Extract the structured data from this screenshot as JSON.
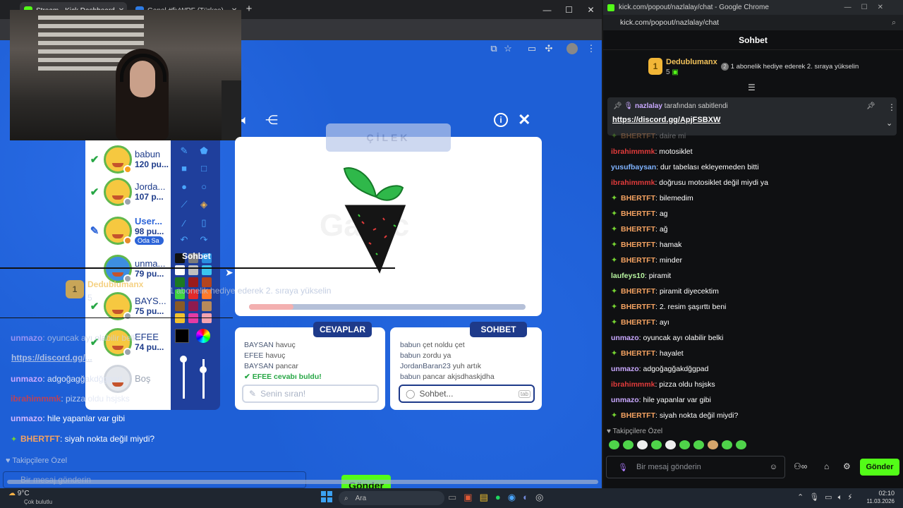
{
  "left_browser": {
    "tabs": [
      {
        "label": "Stream - Kick Dashboard",
        "favicon_color": "#53fc18"
      },
      {
        "label": "Genel #fiyWRF (Türkçe) -",
        "favicon_color": "#2c7be5"
      }
    ],
    "new_tab": "+",
    "window_buttons": [
      "—",
      "☐",
      "✕"
    ]
  },
  "game": {
    "players": [
      {
        "name": "babun",
        "points": "120 pu...",
        "status": "check",
        "dot": "#f59f1c"
      },
      {
        "name": "Jorda...",
        "points": "107 p...",
        "status": "check",
        "dot": "#9aa2ad"
      },
      {
        "name": "User...",
        "points": "98 pu...",
        "status": "pencil",
        "badge": "Oda Sa",
        "dot": "#e58b2a"
      },
      {
        "name": "unma...",
        "points": "79 pu...",
        "status": "none",
        "dot": "#9aa2ad"
      },
      {
        "name": "BAYS...",
        "points": "75 pu...",
        "status": "check",
        "dot": "#9aa2ad"
      },
      {
        "name": "EFEE",
        "points": "74 pu...",
        "status": "check",
        "dot": "#9aa2ad"
      },
      {
        "name": "Boş",
        "points": "",
        "status": "empty",
        "dot": ""
      }
    ],
    "word_hint": "ÇİLEK",
    "watermark": "Gartic",
    "progress_fraction": 0.16,
    "tabs": {
      "answers": "CEVAPLAR",
      "chat": "SOHBET"
    },
    "answers": [
      {
        "user": "BAYSAN",
        "text": "havuç"
      },
      {
        "user": "EFEE",
        "text": "havuç"
      },
      {
        "user": "BAYSAN",
        "text": "pancar"
      }
    ],
    "found": "EFEE cevabı buldu!",
    "answer_placeholder": "Senin sıran!",
    "chat": [
      {
        "user": "babun",
        "text": "çet noldu çet"
      },
      {
        "user": "babun",
        "text": "zordu ya"
      },
      {
        "user": "JordanBaran23",
        "text": "yuh artık"
      },
      {
        "user": "babun",
        "text": "pancar akjsdhaskjdha"
      }
    ],
    "chat_placeholder": "Sohbet...",
    "chat_key": "tab"
  },
  "overlay": {
    "sohbet_label": "Sohbet",
    "rank_user": "Dedublumanx",
    "rank_text": "1 abonelik hediye ederek 2. sıraya yükselin",
    "rank_count": "5",
    "pinned_link": "https://discord.gg/...",
    "lines": [
      {
        "user": "unmazo",
        "text": "oyuncak ayı olabilir belki"
      },
      {
        "user": "BHERTFT",
        "text": "hayalet"
      },
      {
        "user": "unmazo",
        "text": "adgoğagğakdğgpad"
      },
      {
        "user": "ibrahimmmk",
        "text": "pizza oldu hsjsks"
      },
      {
        "user": "unmazo",
        "text": "hile yapanlar var gibi"
      },
      {
        "user": "BHERTFT",
        "text": "siyah nokta değil miydi?"
      }
    ],
    "followers": "Takipçilere Özel",
    "input_placeholder": "Bir mesaj gönderin",
    "send": "Gönder"
  },
  "right": {
    "title": "kick.com/popout/nazlalay/chat - Google Chrome",
    "url": "kick.com/popout/nazlalay/chat",
    "header": "Sohbet",
    "leader": {
      "name": "Dedublumanx",
      "count": "5",
      "rank": "1",
      "promo": "1 abonelik hediye ederek 2. sıraya yükselin",
      "promo_badge": "2"
    },
    "pinned_by": "nazlalay",
    "pinned_suffix": "tarafından sabitlendi",
    "pinned_link": "https://discord.gg/ApjFSBXW",
    "messages": [
      {
        "user": "BHERTFT",
        "text": "daire mi",
        "color": "#f4a261",
        "star": true
      },
      {
        "user": "ibrahimmmk",
        "text": "motosiklet",
        "color": "#e23b3b",
        "star": false
      },
      {
        "user": "yusufbaysan",
        "text": "dur tabelası ekleyemeden bitti",
        "color": "#7fb3ff",
        "star": false
      },
      {
        "user": "ibrahimmmk",
        "text": "doğrusu motosiklet değil miydi ya",
        "color": "#e23b3b",
        "star": false
      },
      {
        "user": "BHERTFT",
        "text": "bilemedim",
        "color": "#f4a261",
        "star": true
      },
      {
        "user": "BHERTFT",
        "text": "ag",
        "color": "#f4a261",
        "star": true
      },
      {
        "user": "BHERTFT",
        "text": "ağ",
        "color": "#f4a261",
        "star": true
      },
      {
        "user": "BHERTFT",
        "text": "hamak",
        "color": "#f4a261",
        "star": true
      },
      {
        "user": "BHERTFT",
        "text": "minder",
        "color": "#f4a261",
        "star": true
      },
      {
        "user": "laufeys10",
        "text": "piramit",
        "color": "#b8f5a0",
        "star": false
      },
      {
        "user": "BHERTFT",
        "text": "piramit diyecektim",
        "color": "#f4a261",
        "star": true
      },
      {
        "user": "BHERTFT",
        "text": "2. resim şaşırttı beni",
        "color": "#f4a261",
        "star": true
      },
      {
        "user": "BHERTFT",
        "text": "ayı",
        "color": "#f4a261",
        "star": true
      },
      {
        "user": "unmazo",
        "text": "oyuncak ayı olabilir belki",
        "color": "#c9a8ff",
        "star": false
      },
      {
        "user": "BHERTFT",
        "text": "hayalet",
        "color": "#f4a261",
        "star": true
      },
      {
        "user": "unmazo",
        "text": "adgoğagğakdğgpad",
        "color": "#c9a8ff",
        "star": false
      },
      {
        "user": "ibrahimmmk",
        "text": "pizza oldu hsjsks",
        "color": "#e23b3b",
        "star": false
      },
      {
        "user": "unmazo",
        "text": "hile yapanlar var gibi",
        "color": "#c9a8ff",
        "star": false
      },
      {
        "user": "BHERTFT",
        "text": "siyah nokta değil miydi?",
        "color": "#f4a261",
        "star": true
      }
    ],
    "followers_label": "Takipçilere Özel",
    "input_placeholder": "Bir mesaj gönderin",
    "send": "Gönder"
  },
  "taskbar": {
    "weather_temp": "9°C",
    "weather_text": "Çok bulutlu",
    "search": "Ara",
    "time": "02:10",
    "date": "11.03.2026"
  }
}
